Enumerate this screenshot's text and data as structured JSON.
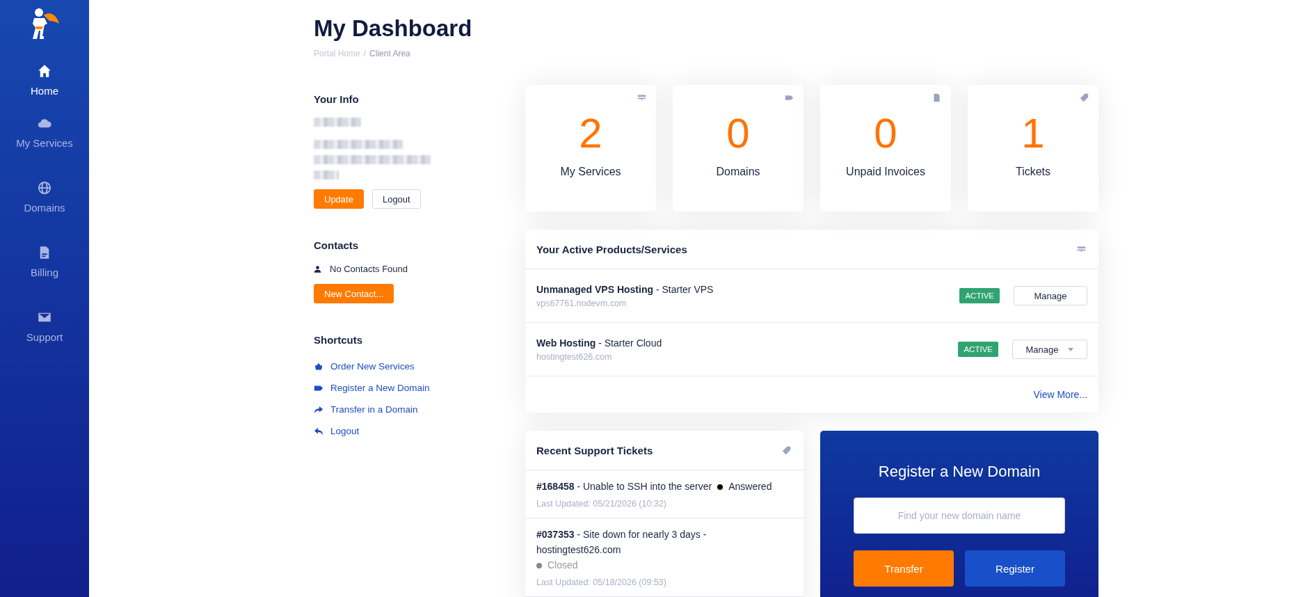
{
  "sidebar": {
    "items": [
      {
        "label": "Home",
        "selected": true
      },
      {
        "label": "My Services",
        "selected": false
      },
      {
        "label": "Domains",
        "selected": false
      },
      {
        "label": "Billing",
        "selected": false
      },
      {
        "label": "Support",
        "selected": false
      }
    ]
  },
  "header": {
    "title": "My Dashboard",
    "separator": "/",
    "breadcrumb": [
      {
        "label": "Portal Home",
        "current": false
      },
      {
        "label": "Client Area",
        "current": true
      }
    ]
  },
  "your_info": {
    "heading": "Your Info",
    "buttons": [
      {
        "label": "Update",
        "kind": "primary"
      },
      {
        "label": "Logout",
        "kind": "outline"
      }
    ]
  },
  "contacts": {
    "heading": "Contacts",
    "empty_text": "No Contacts Found",
    "button": "New Contact..."
  },
  "shortcuts": {
    "heading": "Shortcuts",
    "links": [
      "Order New Services",
      "Register a New Domain",
      "Transfer in a Domain",
      "Logout"
    ]
  },
  "stats": [
    {
      "value": "2",
      "label": "My Services"
    },
    {
      "value": "0",
      "label": "Domains"
    },
    {
      "value": "0",
      "label": "Unpaid Invoices"
    },
    {
      "value": "1",
      "label": "Tickets"
    }
  ],
  "products": {
    "title": "Your Active Products/Services",
    "rows": [
      {
        "title": "**Unmanaged VPS Hosting** - Starter VPS",
        "domain": "vps67761.nodevm.com",
        "status": "ACTIVE",
        "action": "Manage",
        "dropdown": false
      },
      {
        "title": "**Web Hosting** - Starter Cloud",
        "domain": "hostingtest626.com",
        "status": "ACTIVE",
        "action": "Manage",
        "dropdown": true
      }
    ],
    "view_more": "View More..."
  },
  "tickets": {
    "title": "Recent Support Tickets",
    "items": [
      {
        "title": "**#168458** - Unable to SSH into the server",
        "status": "Answered",
        "color": "#000000",
        "updated": "Last Updated: 05/21/2026 (10:32)"
      },
      {
        "title": "**#037353** - Site down for nearly 3 days - hostingtest626.com",
        "status": "Closed",
        "color": "#888888",
        "updated": "Last Updated: 05/18/2026 (09:53)"
      }
    ]
  },
  "domain_search": {
    "title": "Register a New Domain",
    "placeholder": "Find your new domain name",
    "buttons": [
      {
        "label": "Transfer",
        "kind": "primary"
      },
      {
        "label": "Register",
        "kind": "secondary"
      }
    ]
  }
}
